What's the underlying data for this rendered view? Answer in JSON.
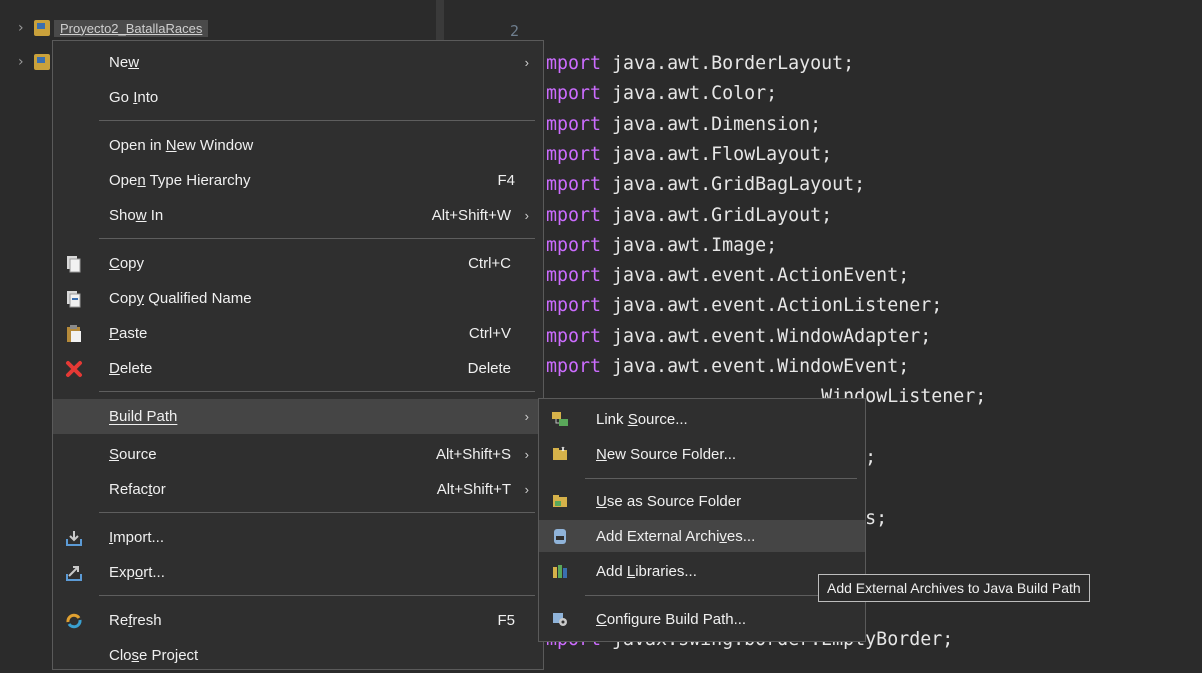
{
  "explorer": {
    "project_name": "Proyecto2_BatallaRaces",
    "line_number": "2"
  },
  "code_lines": [
    {
      "kw": "mport",
      "rest": " java.awt.BorderLayout;"
    },
    {
      "kw": "mport",
      "rest": " java.awt.Color;"
    },
    {
      "kw": "mport",
      "rest": " java.awt.Dimension;"
    },
    {
      "kw": "mport",
      "rest": " java.awt.FlowLayout;"
    },
    {
      "kw": "mport",
      "rest": " java.awt.GridBagLayout;"
    },
    {
      "kw": "mport",
      "rest": " java.awt.GridLayout;"
    },
    {
      "kw": "mport",
      "rest": " java.awt.Image;"
    },
    {
      "kw": "mport",
      "rest": " java.awt.event.ActionEvent;"
    },
    {
      "kw": "mport",
      "rest": " java.awt.event.ActionListener;"
    },
    {
      "kw": "mport",
      "rest": " java.awt.event.WindowAdapter;"
    },
    {
      "kw": "mport",
      "rest": " java.awt.event.WindowEvent;"
    },
    {
      "kw": "",
      "rest": "                         WindowListener;"
    },
    {
      "kw": "",
      "rest": ""
    },
    {
      "kw": "",
      "rest": "                          ist;"
    },
    {
      "kw": "",
      "rest": "                          ;"
    },
    {
      "kw": "",
      "rest": "                         tions;"
    },
    {
      "kw": "",
      "rest": ""
    },
    {
      "kw": "",
      "rest": ""
    },
    {
      "kw": "",
      "rest": ""
    },
    {
      "kw": "mport",
      "rest": " javax.swing.border.EmptyBorder;"
    }
  ],
  "context_menu": {
    "new": {
      "label": "New",
      "mnemonic": "w"
    },
    "go_into": {
      "label": "Go Into"
    },
    "open_new_window": {
      "label": "Open in New Window"
    },
    "open_type_hierarchy": {
      "label": "Open Type Hierarchy",
      "shortcut": "F4"
    },
    "show_in": {
      "label": "Show In",
      "shortcut": "Alt+Shift+W"
    },
    "copy": {
      "label": "Copy",
      "shortcut": "Ctrl+C"
    },
    "copy_qualified": {
      "label": "Copy Qualified Name"
    },
    "paste": {
      "label": "Paste",
      "shortcut": "Ctrl+V"
    },
    "delete": {
      "label": "Delete",
      "shortcut": "Delete"
    },
    "build_path": {
      "label": "Build Path"
    },
    "source": {
      "label": "Source",
      "shortcut": "Alt+Shift+S"
    },
    "refactor": {
      "label": "Refactor",
      "shortcut": "Alt+Shift+T"
    },
    "import": {
      "label": "Import..."
    },
    "export": {
      "label": "Export..."
    },
    "refresh": {
      "label": "Refresh",
      "shortcut": "F5"
    },
    "close_project": {
      "label": "Close Project"
    }
  },
  "submenu": {
    "link_source": {
      "label": "Link Source..."
    },
    "new_source_folder": {
      "label": "New Source Folder..."
    },
    "use_as_source": {
      "label": "Use as Source Folder"
    },
    "add_external_archives": {
      "label": "Add External Archives..."
    },
    "add_libraries": {
      "label": "Add Libraries..."
    },
    "configure_build_path": {
      "label": "Configure Build Path..."
    }
  },
  "tooltip": {
    "text": "Add External Archives to Java Build Path"
  },
  "colors": {
    "keyword": "#cc6cff",
    "menu_bg": "#2f2f2f",
    "highlight": "#454545"
  },
  "icons": {
    "copy": "copy-icon",
    "copy_qualified": "copy-qualified-icon",
    "paste": "paste-icon",
    "delete": "delete-icon",
    "import": "import-icon",
    "export": "export-icon",
    "refresh": "refresh-icon",
    "link_source": "link-source-icon",
    "new_source_folder": "new-source-folder-icon",
    "use_as_source": "use-as-source-icon",
    "add_external_archives": "jar-icon",
    "add_libraries": "library-icon",
    "configure_build_path": "configure-build-path-icon"
  }
}
